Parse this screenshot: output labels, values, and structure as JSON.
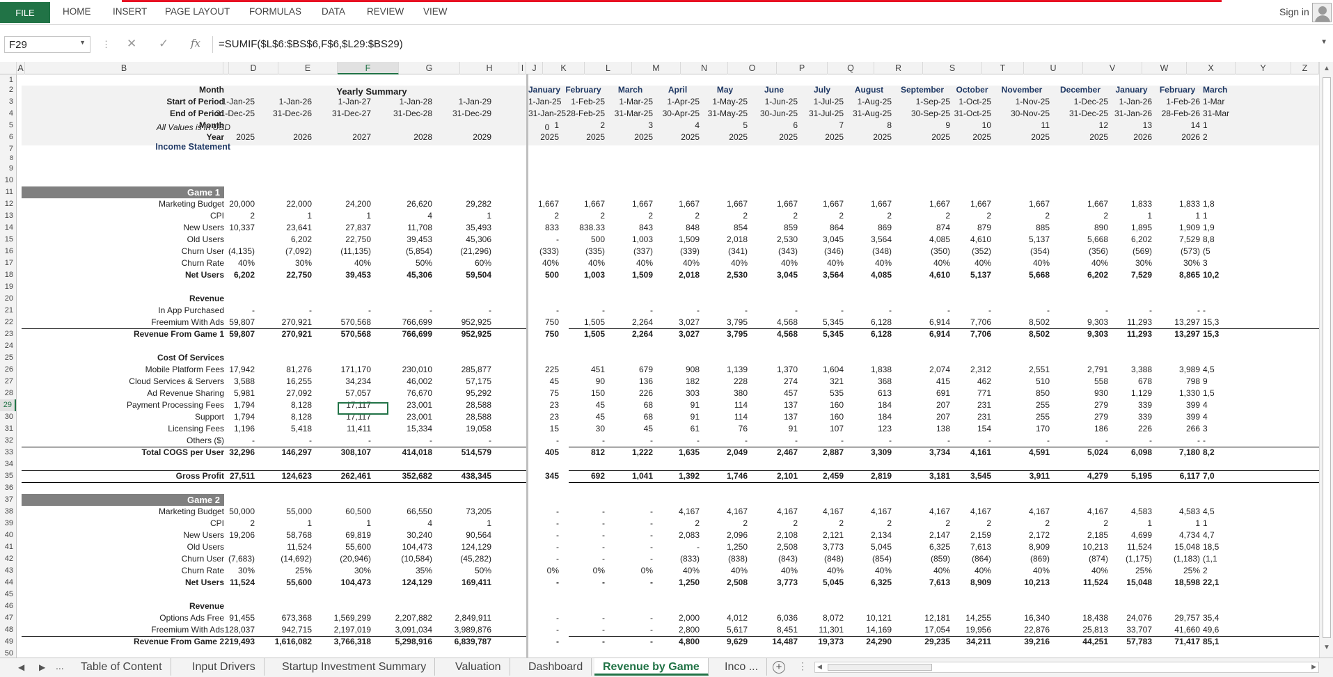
{
  "app": {
    "ribbon_tabs": [
      "FILE",
      "HOME",
      "INSERT",
      "PAGE LAYOUT",
      "FORMULAS",
      "DATA",
      "REVIEW",
      "VIEW"
    ],
    "sign_in": "Sign in",
    "name_box": "F29",
    "formula": "=SUMIF($L$6:$BS$6,F$6,$L29:$BS29)",
    "fx_label": "fx"
  },
  "columns": [
    "A",
    "B",
    "",
    "D",
    "E",
    "F",
    "G",
    "H",
    "I",
    "J",
    "K",
    "L",
    "M",
    "N",
    "O",
    "P",
    "Q",
    "R",
    "S",
    "T",
    "U",
    "V",
    "W",
    "X",
    "Y",
    "Z"
  ],
  "rows": [
    "1",
    "2",
    "3",
    "4",
    "5",
    "6",
    "7",
    "8",
    "9",
    "10",
    "11",
    "12",
    "13",
    "14",
    "15",
    "16",
    "17",
    "18",
    "19",
    "20",
    "21",
    "22",
    "23",
    "24",
    "25",
    "26",
    "27",
    "28",
    "29",
    "30",
    "31",
    "32",
    "33",
    "34",
    "35",
    "36",
    "37",
    "38",
    "39",
    "40",
    "41",
    "42",
    "43",
    "44",
    "45",
    "46",
    "47",
    "48",
    "49",
    "50"
  ],
  "sheet": {
    "yearly_summary_title": "Yearly Summary",
    "all_values_note": "All Values is in USD",
    "income_statement": "Income Statement",
    "k6": "0",
    "header_rows": [
      {
        "label": "Month",
        "annual": [
          "",
          "",
          "",
          "",
          ""
        ],
        "monthly": [
          "January",
          "February",
          "March",
          "April",
          "May",
          "June",
          "July",
          "August",
          "September",
          "October",
          "November",
          "December",
          "January",
          "February",
          "March"
        ]
      },
      {
        "label": "Start of Period",
        "annual": [
          "1-Jan-25",
          "1-Jan-26",
          "1-Jan-27",
          "1-Jan-28",
          "1-Jan-29"
        ],
        "monthly": [
          "1-Jan-25",
          "1-Feb-25",
          "1-Mar-25",
          "1-Apr-25",
          "1-May-25",
          "1-Jun-25",
          "1-Jul-25",
          "1-Aug-25",
          "1-Sep-25",
          "1-Oct-25",
          "1-Nov-25",
          "1-Dec-25",
          "1-Jan-26",
          "1-Feb-26",
          "1-Mar"
        ]
      },
      {
        "label": "End of Period",
        "annual": [
          "31-Dec-25",
          "31-Dec-26",
          "31-Dec-27",
          "31-Dec-28",
          "31-Dec-29"
        ],
        "monthly": [
          "31-Jan-25",
          "28-Feb-25",
          "31-Mar-25",
          "30-Apr-25",
          "31-May-25",
          "30-Jun-25",
          "31-Jul-25",
          "31-Aug-25",
          "30-Sep-25",
          "31-Oct-25",
          "30-Nov-25",
          "31-Dec-25",
          "31-Jan-26",
          "28-Feb-26",
          "31-Mar"
        ]
      },
      {
        "label": "Month",
        "annual": [
          "",
          "",
          "",
          "",
          ""
        ],
        "monthly": [
          "1",
          "2",
          "3",
          "4",
          "5",
          "6",
          "7",
          "8",
          "9",
          "10",
          "11",
          "12",
          "13",
          "14",
          "1"
        ]
      },
      {
        "label": "Year",
        "annual": [
          "2025",
          "2026",
          "2027",
          "2028",
          "2029"
        ],
        "monthly": [
          "2025",
          "2025",
          "2025",
          "2025",
          "2025",
          "2025",
          "2025",
          "2025",
          "2025",
          "2025",
          "2025",
          "2025",
          "2026",
          "2026",
          "2"
        ]
      }
    ],
    "game1": {
      "title": "Game 1",
      "rows": [
        {
          "label": "Marketing Budget",
          "annual": [
            "20,000",
            "22,000",
            "24,200",
            "26,620",
            "29,282"
          ],
          "monthly": [
            "1,667",
            "1,667",
            "1,667",
            "1,667",
            "1,667",
            "1,667",
            "1,667",
            "1,667",
            "1,667",
            "1,667",
            "1,667",
            "1,667",
            "1,833",
            "1,833",
            "1,8"
          ]
        },
        {
          "label": "CPI",
          "annual": [
            "2",
            "1",
            "1",
            "4",
            "1"
          ],
          "monthly": [
            "2",
            "2",
            "2",
            "2",
            "2",
            "2",
            "2",
            "2",
            "2",
            "2",
            "2",
            "2",
            "1",
            "1",
            "1"
          ]
        },
        {
          "label": "New Users",
          "annual": [
            "10,337",
            "23,641",
            "27,837",
            "11,708",
            "35,493"
          ],
          "monthly": [
            "833",
            "838.33",
            "843",
            "848",
            "854",
            "859",
            "864",
            "869",
            "874",
            "879",
            "885",
            "890",
            "1,895",
            "1,909",
            "1,9"
          ]
        },
        {
          "label": "Old Users",
          "annual": [
            "",
            "6,202",
            "22,750",
            "39,453",
            "45,306"
          ],
          "monthly": [
            "-",
            "500",
            "1,003",
            "1,509",
            "2,018",
            "2,530",
            "3,045",
            "3,564",
            "4,085",
            "4,610",
            "5,137",
            "5,668",
            "6,202",
            "7,529",
            "8,8"
          ]
        },
        {
          "label": "Churn User",
          "annual": [
            "(4,135)",
            "(7,092)",
            "(11,135)",
            "(5,854)",
            "(21,296)"
          ],
          "monthly": [
            "(333)",
            "(335)",
            "(337)",
            "(339)",
            "(341)",
            "(343)",
            "(346)",
            "(348)",
            "(350)",
            "(352)",
            "(354)",
            "(356)",
            "(569)",
            "(573)",
            "(5"
          ]
        },
        {
          "label": "Churn Rate",
          "annual": [
            "40%",
            "30%",
            "40%",
            "50%",
            "60%"
          ],
          "monthly": [
            "40%",
            "40%",
            "40%",
            "40%",
            "40%",
            "40%",
            "40%",
            "40%",
            "40%",
            "40%",
            "40%",
            "40%",
            "30%",
            "30%",
            "3"
          ]
        },
        {
          "label": "Net Users",
          "bold": true,
          "annual": [
            "6,202",
            "22,750",
            "39,453",
            "45,306",
            "59,504"
          ],
          "monthly": [
            "500",
            "1,003",
            "1,509",
            "2,018",
            "2,530",
            "3,045",
            "3,564",
            "4,085",
            "4,610",
            "5,137",
            "5,668",
            "6,202",
            "7,529",
            "8,865",
            "10,2"
          ]
        }
      ],
      "revenue_title": "Revenue",
      "revenue_rows": [
        {
          "label": "In App Purchased",
          "annual": [
            "-",
            "-",
            "-",
            "-",
            "-"
          ],
          "monthly": [
            "-",
            "-",
            "-",
            "-",
            "-",
            "-",
            "-",
            "-",
            "-",
            "-",
            "-",
            "-",
            "-",
            "-",
            "-"
          ]
        },
        {
          "label": "Freemium With Ads",
          "annual": [
            "59,807",
            "270,921",
            "570,568",
            "766,699",
            "952,925"
          ],
          "monthly": [
            "750",
            "1,505",
            "2,264",
            "3,027",
            "3,795",
            "4,568",
            "5,345",
            "6,128",
            "6,914",
            "7,706",
            "8,502",
            "9,303",
            "11,293",
            "13,297",
            "15,3"
          ]
        },
        {
          "label": "Revenue From Game 1",
          "bold": true,
          "annual": [
            "59,807",
            "270,921",
            "570,568",
            "766,699",
            "952,925"
          ],
          "monthly": [
            "750",
            "1,505",
            "2,264",
            "3,027",
            "3,795",
            "4,568",
            "5,345",
            "6,128",
            "6,914",
            "7,706",
            "8,502",
            "9,303",
            "11,293",
            "13,297",
            "15,3"
          ]
        }
      ],
      "cos_title": "Cost Of Services",
      "cos_rows": [
        {
          "label": "Mobile Platform Fees",
          "annual": [
            "17,942",
            "81,276",
            "171,170",
            "230,010",
            "285,877"
          ],
          "monthly": [
            "225",
            "451",
            "679",
            "908",
            "1,139",
            "1,370",
            "1,604",
            "1,838",
            "2,074",
            "2,312",
            "2,551",
            "2,791",
            "3,388",
            "3,989",
            "4,5"
          ]
        },
        {
          "label": "Cloud Services & Servers",
          "annual": [
            "3,588",
            "16,255",
            "34,234",
            "46,002",
            "57,175"
          ],
          "monthly": [
            "45",
            "90",
            "136",
            "182",
            "228",
            "274",
            "321",
            "368",
            "415",
            "462",
            "510",
            "558",
            "678",
            "798",
            "9"
          ]
        },
        {
          "label": "Ad Revenue Sharing",
          "annual": [
            "5,981",
            "27,092",
            "57,057",
            "76,670",
            "95,292"
          ],
          "monthly": [
            "75",
            "150",
            "226",
            "303",
            "380",
            "457",
            "535",
            "613",
            "691",
            "771",
            "850",
            "930",
            "1,129",
            "1,330",
            "1,5"
          ]
        },
        {
          "label": "Payment Processing Fees",
          "annual": [
            "1,794",
            "8,128",
            "17,117",
            "23,001",
            "28,588"
          ],
          "monthly": [
            "23",
            "45",
            "68",
            "91",
            "114",
            "137",
            "160",
            "184",
            "207",
            "231",
            "255",
            "279",
            "339",
            "399",
            "4"
          ]
        },
        {
          "label": "Support",
          "annual": [
            "1,794",
            "8,128",
            "17,117",
            "23,001",
            "28,588"
          ],
          "monthly": [
            "23",
            "45",
            "68",
            "91",
            "114",
            "137",
            "160",
            "184",
            "207",
            "231",
            "255",
            "279",
            "339",
            "399",
            "4"
          ]
        },
        {
          "label": "Licensing Fees",
          "annual": [
            "1,196",
            "5,418",
            "11,411",
            "15,334",
            "19,058"
          ],
          "monthly": [
            "15",
            "30",
            "45",
            "61",
            "76",
            "91",
            "107",
            "123",
            "138",
            "154",
            "170",
            "186",
            "226",
            "266",
            "3"
          ]
        },
        {
          "label": "Others ($)",
          "annual": [
            "-",
            "-",
            "-",
            "-",
            "-"
          ],
          "monthly": [
            "-",
            "-",
            "-",
            "-",
            "-",
            "-",
            "-",
            "-",
            "-",
            "-",
            "-",
            "-",
            "-",
            "-",
            "-"
          ]
        },
        {
          "label": "Total COGS per User",
          "bold": true,
          "annual": [
            "32,296",
            "146,297",
            "308,107",
            "414,018",
            "514,579"
          ],
          "monthly": [
            "405",
            "812",
            "1,222",
            "1,635",
            "2,049",
            "2,467",
            "2,887",
            "3,309",
            "3,734",
            "4,161",
            "4,591",
            "5,024",
            "6,098",
            "7,180",
            "8,2"
          ]
        }
      ],
      "gross_profit": {
        "label": "Gross Profit",
        "annual": [
          "27,511",
          "124,623",
          "262,461",
          "352,682",
          "438,345"
        ],
        "monthly": [
          "345",
          "692",
          "1,041",
          "1,392",
          "1,746",
          "2,101",
          "2,459",
          "2,819",
          "3,181",
          "3,545",
          "3,911",
          "4,279",
          "5,195",
          "6,117",
          "7,0"
        ]
      }
    },
    "game2": {
      "title": "Game 2",
      "rows": [
        {
          "label": "Marketing Budget",
          "annual": [
            "50,000",
            "55,000",
            "60,500",
            "66,550",
            "73,205"
          ],
          "monthly": [
            "-",
            "-",
            "-",
            "4,167",
            "4,167",
            "4,167",
            "4,167",
            "4,167",
            "4,167",
            "4,167",
            "4,167",
            "4,167",
            "4,583",
            "4,583",
            "4,5"
          ]
        },
        {
          "label": "CPI",
          "annual": [
            "2",
            "1",
            "1",
            "4",
            "1"
          ],
          "monthly": [
            "-",
            "-",
            "-",
            "2",
            "2",
            "2",
            "2",
            "2",
            "2",
            "2",
            "2",
            "2",
            "1",
            "1",
            "1"
          ]
        },
        {
          "label": "New Users",
          "annual": [
            "19,206",
            "58,768",
            "69,819",
            "30,240",
            "90,564"
          ],
          "monthly": [
            "-",
            "-",
            "-",
            "2,083",
            "2,096",
            "2,108",
            "2,121",
            "2,134",
            "2,147",
            "2,159",
            "2,172",
            "2,185",
            "4,699",
            "4,734",
            "4,7"
          ]
        },
        {
          "label": "Old Users",
          "annual": [
            "",
            "11,524",
            "55,600",
            "104,473",
            "124,129"
          ],
          "monthly": [
            "-",
            "-",
            "-",
            "-",
            "1,250",
            "2,508",
            "3,773",
            "5,045",
            "6,325",
            "7,613",
            "8,909",
            "10,213",
            "11,524",
            "15,048",
            "18,5"
          ]
        },
        {
          "label": "Churn User",
          "annual": [
            "(7,683)",
            "(14,692)",
            "(20,946)",
            "(10,584)",
            "(45,282)"
          ],
          "monthly": [
            "-",
            "-",
            "-",
            "(833)",
            "(838)",
            "(843)",
            "(848)",
            "(854)",
            "(859)",
            "(864)",
            "(869)",
            "(874)",
            "(1,175)",
            "(1,183)",
            "(1,1"
          ]
        },
        {
          "label": "Churn Rate",
          "annual": [
            "30%",
            "25%",
            "30%",
            "35%",
            "50%"
          ],
          "monthly": [
            "0%",
            "0%",
            "0%",
            "40%",
            "40%",
            "40%",
            "40%",
            "40%",
            "40%",
            "40%",
            "40%",
            "40%",
            "25%",
            "25%",
            "2"
          ]
        },
        {
          "label": "Net Users",
          "bold": true,
          "annual": [
            "11,524",
            "55,600",
            "104,473",
            "124,129",
            "169,411"
          ],
          "monthly": [
            "-",
            "-",
            "-",
            "1,250",
            "2,508",
            "3,773",
            "5,045",
            "6,325",
            "7,613",
            "8,909",
            "10,213",
            "11,524",
            "15,048",
            "18,598",
            "22,1"
          ]
        }
      ],
      "revenue_title": "Revenue",
      "revenue_rows": [
        {
          "label": "Options Ads Free",
          "annual": [
            "91,455",
            "673,368",
            "1,569,299",
            "2,207,882",
            "2,849,911"
          ],
          "monthly": [
            "-",
            "-",
            "-",
            "2,000",
            "4,012",
            "6,036",
            "8,072",
            "10,121",
            "12,181",
            "14,255",
            "16,340",
            "18,438",
            "24,076",
            "29,757",
            "35,4"
          ]
        },
        {
          "label": "Freemium With Ads",
          "annual": [
            "128,037",
            "942,715",
            "2,197,019",
            "3,091,034",
            "3,989,876"
          ],
          "monthly": [
            "-",
            "-",
            "-",
            "2,800",
            "5,617",
            "8,451",
            "11,301",
            "14,169",
            "17,054",
            "19,956",
            "22,876",
            "25,813",
            "33,707",
            "41,660",
            "49,6"
          ]
        },
        {
          "label": "Revenue From Game 2",
          "bold": true,
          "annual": [
            "219,493",
            "1,616,082",
            "3,766,318",
            "5,298,916",
            "6,839,787"
          ],
          "monthly": [
            "-",
            "-",
            "-",
            "4,800",
            "9,629",
            "14,487",
            "19,373",
            "24,290",
            "29,235",
            "34,211",
            "39,216",
            "44,251",
            "57,783",
            "71,417",
            "85,1"
          ]
        }
      ]
    }
  },
  "sheet_tabs": [
    "Table of Content",
    "Input Drivers",
    "Startup Investment Summary",
    "Valuation",
    "Dashboard",
    "Revenue by Game",
    "Inco ..."
  ],
  "active_tab": "Revenue by Game",
  "tab_nav_ellipsis": "..."
}
